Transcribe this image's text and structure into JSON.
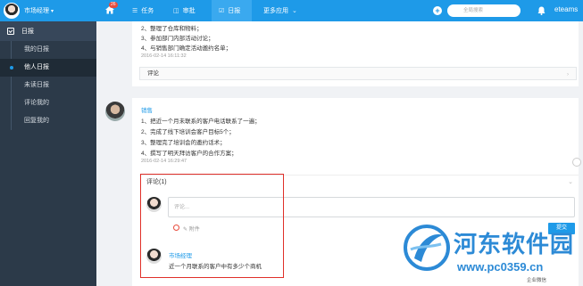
{
  "topbar": {
    "user_name": "市场经理",
    "notification_count": "26",
    "nav": [
      {
        "label": "任务",
        "icon": "list-icon"
      },
      {
        "label": "审批",
        "icon": "approval-icon"
      },
      {
        "label": "日报",
        "icon": "daily-report-icon",
        "active": true
      },
      {
        "label": "更多应用",
        "icon": "chevron-down-icon"
      }
    ],
    "search_placeholder": "全局搜索",
    "brand": "eteams"
  },
  "sidebar": {
    "title": "日报",
    "items": [
      "我的日报",
      "他人日报",
      "未读日报",
      "评论我的",
      "回复我的"
    ],
    "active_index": 1
  },
  "report1": {
    "lines": [
      "2、整理了仓库和物料；",
      "3、参加部门内部活动讨论；",
      "4、与销售部门确定活动邀约名单；"
    ],
    "time": "2016-02-14 16:11:32",
    "comment_label": "评论"
  },
  "report2": {
    "author": "销售",
    "lines": [
      "1、把近一个月未联系的客户电话联系了一遍；",
      "2、完成了线下培训会客户目标5个；",
      "3、整理完了培训会的邀约话术；",
      "4、撰写了明天拜访客户的合作方案；"
    ],
    "time": "2016-02-14 16:29:47",
    "comment_header": "评论(1)",
    "input_placeholder": "评论...",
    "attach_label": "附件",
    "send_label": "提交",
    "reply_name": "市场经理",
    "reply_text": "近一个月联系的客户中有多少个商机"
  },
  "watermark": {
    "title": "河东软件园",
    "url": "www.pc0359.cn",
    "sub": "企业微信"
  },
  "colors": {
    "primary": "#1e9ae8",
    "sidebar": "#2c3a49",
    "highlight": "#e0302a"
  }
}
